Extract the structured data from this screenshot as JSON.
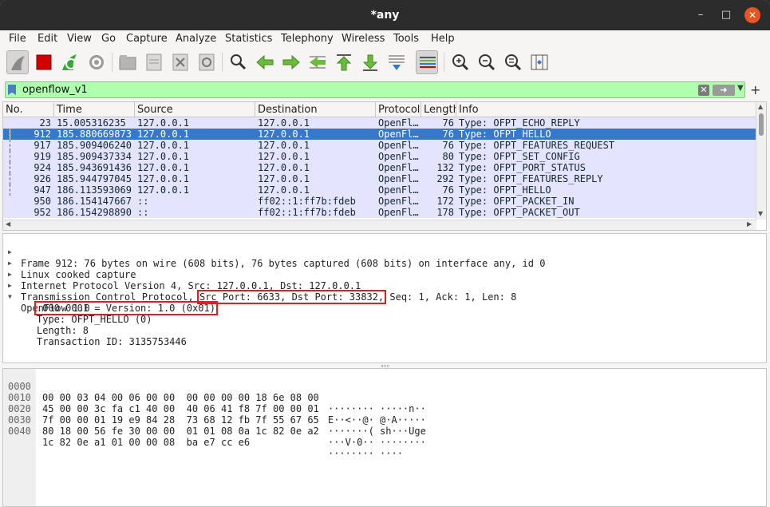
{
  "window": {
    "title": "*any",
    "min_icon": "minimize-icon",
    "max_icon": "maximize-icon",
    "close_icon": "close-icon"
  },
  "menu": [
    "File",
    "Edit",
    "View",
    "Go",
    "Capture",
    "Analyze",
    "Statistics",
    "Telephony",
    "Wireless",
    "Tools",
    "Help"
  ],
  "toolbar": {
    "icons": [
      "shark-fin-start-icon",
      "stop-square-icon",
      "restart-capture-icon",
      "capture-options-gear-icon",
      "open-file-icon",
      "save-file-icon",
      "close-file-icon",
      "reload-file-icon",
      "find-packet-icon",
      "go-back-icon",
      "go-forward-icon",
      "go-to-packet-icon",
      "go-first-icon",
      "go-last-icon",
      "autoscroll-icon",
      "colorize-icon",
      "zoom-in-icon",
      "zoom-out-icon",
      "zoom-normal-icon",
      "resize-columns-icon"
    ],
    "colors": {
      "stop": "#d40000",
      "arrows": "#4caf50",
      "accent": "#e95420"
    }
  },
  "filter": {
    "value": "openflow_v1",
    "clear_icon": "clear-filter-icon",
    "apply_icon": "apply-filter-arrow-icon",
    "dropdown_icon": "filter-history-chevron-icon",
    "add_icon": "add-filter-button-icon"
  },
  "packet_list": {
    "columns": [
      "No.",
      "Time",
      "Source",
      "Destination",
      "Protocol",
      "Length",
      "Info"
    ],
    "rows": [
      {
        "no": "23",
        "time": "15.005316235",
        "src": "127.0.0.1",
        "dst": "127.0.0.1",
        "proto": "OpenFl…",
        "len": "76",
        "info": "Type: OFPT_ECHO_REPLY",
        "selected": false
      },
      {
        "no": "912",
        "time": "185.880669873",
        "src": "127.0.0.1",
        "dst": "127.0.0.1",
        "proto": "OpenFl…",
        "len": "76",
        "info": "Type: OFPT_HELLO",
        "selected": true
      },
      {
        "no": "917",
        "time": "185.909406240",
        "src": "127.0.0.1",
        "dst": "127.0.0.1",
        "proto": "OpenFl…",
        "len": "76",
        "info": "Type: OFPT_FEATURES_REQUEST",
        "selected": false
      },
      {
        "no": "919",
        "time": "185.909437334",
        "src": "127.0.0.1",
        "dst": "127.0.0.1",
        "proto": "OpenFl…",
        "len": "80",
        "info": "Type: OFPT_SET_CONFIG",
        "selected": false
      },
      {
        "no": "924",
        "time": "185.943691436",
        "src": "127.0.0.1",
        "dst": "127.0.0.1",
        "proto": "OpenFl…",
        "len": "132",
        "info": "Type: OFPT_PORT_STATUS",
        "selected": false
      },
      {
        "no": "926",
        "time": "185.944797045",
        "src": "127.0.0.1",
        "dst": "127.0.0.1",
        "proto": "OpenFl…",
        "len": "292",
        "info": "Type: OFPT_FEATURES_REPLY",
        "selected": false
      },
      {
        "no": "947",
        "time": "186.113593069",
        "src": "127.0.0.1",
        "dst": "127.0.0.1",
        "proto": "OpenFl…",
        "len": "76",
        "info": "Type: OFPT_HELLO",
        "selected": false
      },
      {
        "no": "950",
        "time": "186.154147667",
        "src": "::",
        "dst": "ff02::1:ff7b:fdeb",
        "proto": "OpenFl…",
        "len": "172",
        "info": "Type: OFPT_PACKET_IN",
        "selected": false
      },
      {
        "no": "952",
        "time": "186.154298890",
        "src": "::",
        "dst": "ff02::1:ff7b:fdeb",
        "proto": "OpenFl…",
        "len": "178",
        "info": "Type: OFPT_PACKET_OUT",
        "selected": false
      }
    ],
    "colors": {
      "row_bg": "#e4e4ff",
      "selected_bg": "#3778c9"
    }
  },
  "details": {
    "frame": "Frame 912: 76 bytes on wire (608 bits), 76 bytes captured (608 bits) on interface any, id 0",
    "linux": "Linux cooked capture",
    "ip": "Internet Protocol Version 4, Src: 127.0.0.1, Dst: 127.0.0.1",
    "tcp_prefix": "Transmission Control Protocol, ",
    "tcp_highlight": "Src Port: 6633, Dst Port: 33832,",
    "tcp_suffix": " Seq: 1, Ack: 1, Len: 8",
    "openflow": "OpenFlow 1.0",
    "version": ".000 0001 = Version: 1.0 (0x01)",
    "type": "Type: OFPT_HELLO (0)",
    "length": "Length: 8",
    "xid": "Transaction ID: 3135753446",
    "highlight_color": "#e02020"
  },
  "bytes": [
    {
      "off": "0000",
      "hex": "00 00 03 04 00 06 00 00  00 00 00 00 18 6e 08 00",
      "ascii": "········ ·····n··"
    },
    {
      "off": "0010",
      "hex": "45 00 00 3c fa c1 40 00  40 06 41 f8 7f 00 00 01",
      "ascii": "E··<··@· @·A·····"
    },
    {
      "off": "0020",
      "hex": "7f 00 00 01 19 e9 84 28  73 68 12 fb 7f 55 67 65",
      "ascii": "·······( sh···Uge"
    },
    {
      "off": "0030",
      "hex": "80 18 00 56 fe 30 00 00  01 01 08 0a 1c 82 0e a2",
      "ascii": "···V·0·· ········"
    },
    {
      "off": "0040",
      "hex": "1c 82 0e a1 01 00 00 08  ba e7 cc e6",
      "ascii": "········ ····"
    }
  ]
}
